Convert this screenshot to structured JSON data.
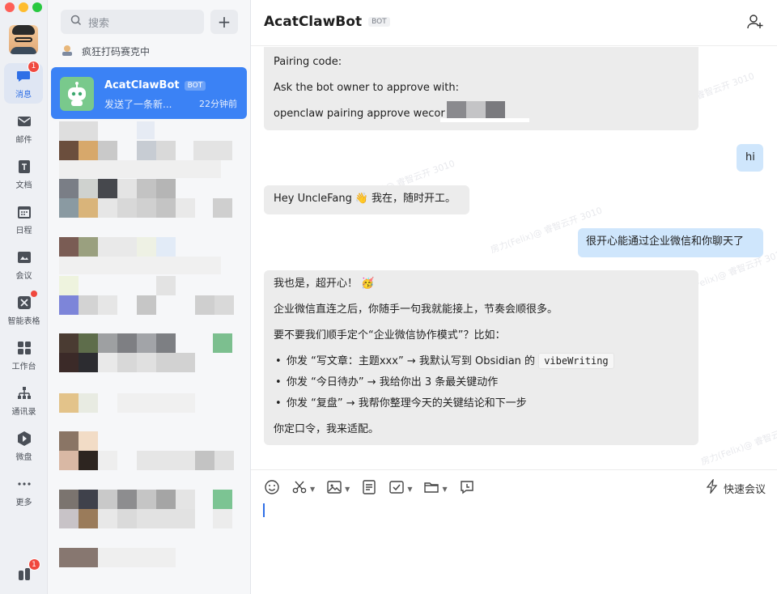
{
  "nav": {
    "items": [
      {
        "label": "消息",
        "icon": "chat-bubble-icon",
        "badge": "1",
        "active": true
      },
      {
        "label": "邮件",
        "icon": "mail-icon"
      },
      {
        "label": "文档",
        "icon": "document-icon"
      },
      {
        "label": "日程",
        "icon": "calendar-icon"
      },
      {
        "label": "会议",
        "icon": "meeting-icon"
      },
      {
        "label": "智能表格",
        "icon": "smart-sheet-icon",
        "dot": true
      },
      {
        "label": "工作台",
        "icon": "workbench-icon"
      },
      {
        "label": "通讯录",
        "icon": "contacts-icon"
      },
      {
        "label": "微盘",
        "icon": "drive-icon"
      },
      {
        "label": "更多",
        "icon": "more-icon"
      }
    ],
    "bottom_badge": "1"
  },
  "list": {
    "search_placeholder": "搜索",
    "status_text": "疯狂打码赛克中",
    "active_conversation": {
      "name": "AcatClawBot",
      "tag": "BOT",
      "preview": "发送了一条新...",
      "time": "22分钟前"
    }
  },
  "chat": {
    "title": "AcatClawBot",
    "tag": "BOT",
    "messages": {
      "m1_line1": "Pairing code:",
      "m1_line2": "Ask the bot owner to approve with:",
      "m1_line3": "openclaw pairing approve wecor",
      "m2": "hi",
      "m3_text": "Hey UncleFang",
      "m3_emoji": "👋",
      "m3_tail": "我在，随时开工。",
      "m4": "很开心能通过企业微信和你聊天了",
      "m5_line1": "我也是，超开心！",
      "m5_line1_emoji": "🥳",
      "m5_line2": "企业微信直连之后，你随手一句我就能接上，节奏会顺很多。",
      "m5_line3": "要不要我们顺手定个“企业微信协作模式”？比如：",
      "m5_bullet1_text": "你发 “写文章：主题xxx” → 我默认写到 Obsidian 的",
      "m5_bullet1_code": "vibeWriting",
      "m5_bullet2": "你发 “今日待办” → 我给你出 3 条最关键动作",
      "m5_bullet3": "你发 “复盘” → 我帮你整理今天的关键结论和下一步",
      "m5_line4": "你定口令，我来适配。"
    },
    "watermarks": [
      "房力(Felix)@ 睿智云开 3010",
      "房力(Felix)@ 睿智云开 3010",
      "房力(Felix)@ 睿智云开 3010",
      "房力(Felix)@ 睿智云开 3010",
      "房力(Felix)@ 睿智云开 3010"
    ],
    "composer": {
      "quick_meeting": "快速会议"
    }
  }
}
